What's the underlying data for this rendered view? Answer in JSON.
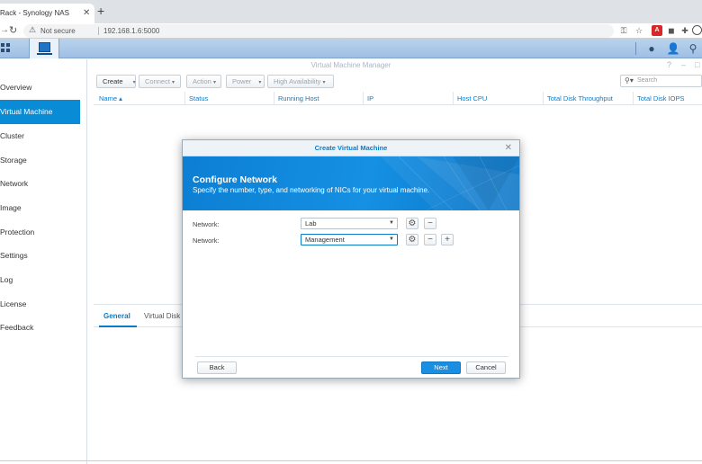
{
  "browser": {
    "tab_title": "Rack - Synology NAS",
    "tab_close": "✕",
    "new_tab": "+",
    "security_label": "Not secure",
    "url": "192.168.1.6:5000"
  },
  "app": {
    "title": "Virtual Machine Manager",
    "window_controls": [
      "?",
      "–",
      "□"
    ]
  },
  "sidebar": {
    "items": [
      {
        "label": "Overview",
        "active": false
      },
      {
        "label": "Virtual Machine",
        "active": true
      },
      {
        "label": "Cluster",
        "active": false
      },
      {
        "label": "Storage",
        "active": false
      },
      {
        "label": "Network",
        "active": false
      },
      {
        "label": "Image",
        "active": false
      },
      {
        "label": "Protection",
        "active": false
      },
      {
        "label": "Settings",
        "active": false
      },
      {
        "label": "Log",
        "active": false
      },
      {
        "label": "License",
        "active": false
      },
      {
        "label": "Feedback",
        "active": false
      }
    ]
  },
  "toolbar": {
    "create": "Create",
    "connect": "Connect",
    "action": "Action",
    "power": "Power",
    "high_availability": "High Availability",
    "search_placeholder": "Search"
  },
  "table": {
    "columns": [
      "Name ▴",
      "Status",
      "Running Host",
      "IP",
      "Host CPU",
      "Total Disk Throughput",
      "Total Disk IOPS"
    ]
  },
  "detail_tabs": {
    "general": "General",
    "virtual_disk": "Virtual Disk"
  },
  "modal": {
    "title": "Create Virtual Machine",
    "close": "✕",
    "heading": "Configure Network",
    "subheading": "Specify the number, type, and networking of NICs for your virtual machine.",
    "networks": [
      {
        "label": "Network:",
        "value": "Lab"
      },
      {
        "label": "Network:",
        "value": "Management"
      }
    ],
    "back": "Back",
    "next": "Next",
    "cancel": "Cancel"
  },
  "colors": {
    "accent": "#0a8bd6",
    "banner": "#1590e3",
    "primary_button": "#1a8ee1"
  }
}
